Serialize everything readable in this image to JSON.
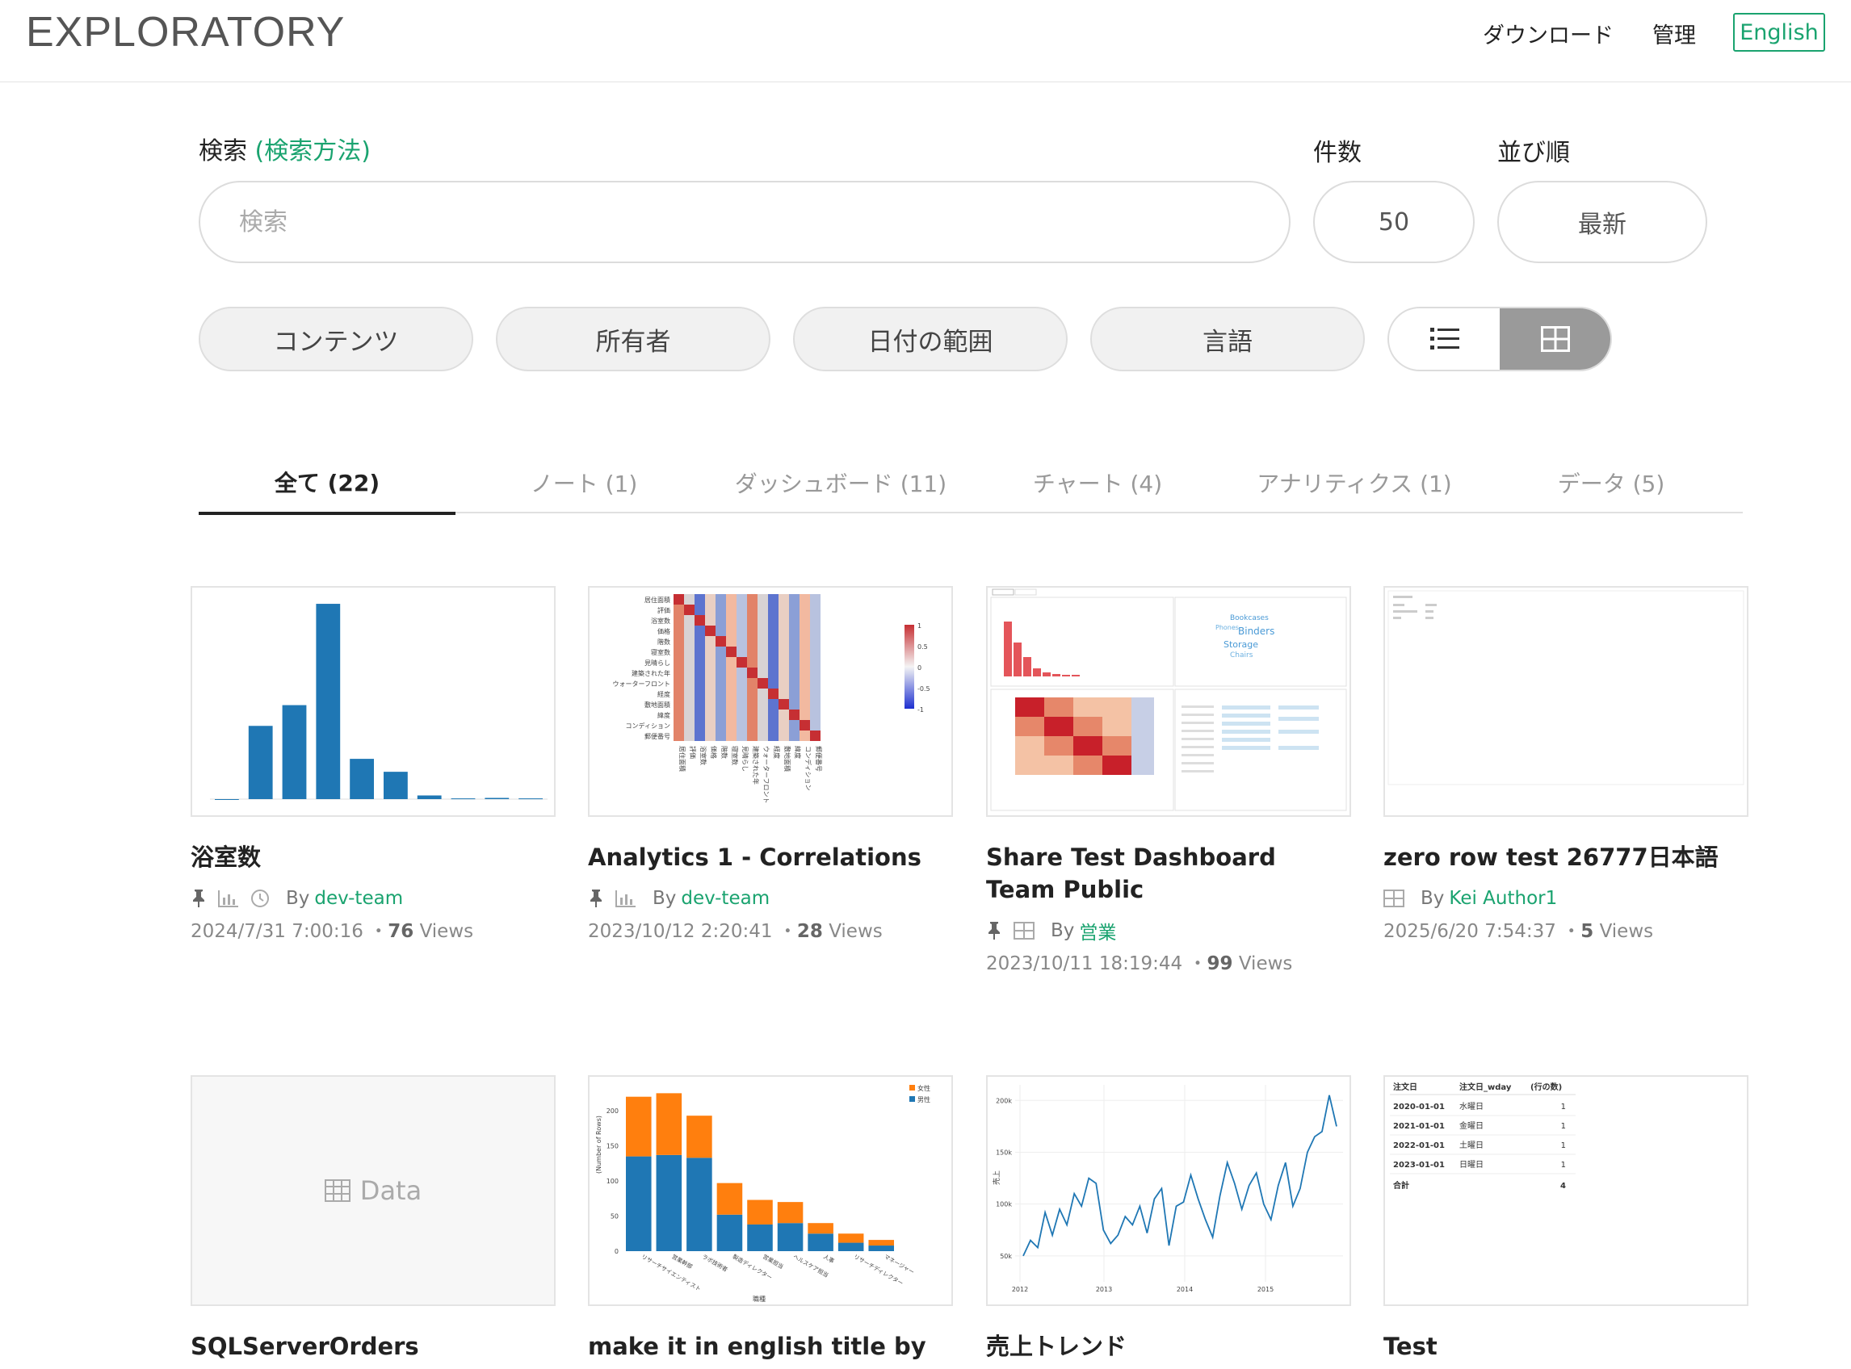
{
  "header": {
    "logo": "EXPLORATORY",
    "nav": {
      "download": "ダウンロード",
      "admin": "管理"
    },
    "language_button": "English"
  },
  "search": {
    "label": "検索",
    "help_link": "(検索方法)",
    "placeholder": "検索",
    "count_label": "件数",
    "count_value": "50",
    "sort_label": "並び順",
    "sort_value": "最新"
  },
  "filters": [
    "コンテンツ",
    "所有者",
    "日付の範囲",
    "言語"
  ],
  "view_toggle": {
    "list_icon": "list-icon",
    "grid_icon": "grid-icon",
    "active": "grid"
  },
  "tabs": [
    {
      "label": "全て (22)",
      "active": true
    },
    {
      "label": "ノート (1)",
      "active": false
    },
    {
      "label": "ダッシュボード (11)",
      "active": false
    },
    {
      "label": "チャート (4)",
      "active": false
    },
    {
      "label": "アナリティクス (1)",
      "active": false
    },
    {
      "label": "データ (5)",
      "active": false
    }
  ],
  "cards": [
    {
      "title": "浴室数",
      "pinned": true,
      "type_icon": "chart-icon",
      "clock": true,
      "by": "By",
      "owner": "dev-team",
      "date": "2024/7/31 7:00:16",
      "views": "76",
      "views_label": "Views"
    },
    {
      "title": "Analytics 1 - Correlations",
      "pinned": true,
      "type_icon": "chart-icon",
      "clock": false,
      "by": "By",
      "owner": "dev-team",
      "date": "2023/10/12 2:20:41",
      "views": "28",
      "views_label": "Views"
    },
    {
      "title": "Share Test Dashboard Team Public",
      "pinned": true,
      "type_icon": "dashboard-icon",
      "clock": false,
      "by": "By",
      "owner": "営業",
      "date": "2023/10/11 18:19:44",
      "views": "99",
      "views_label": "Views"
    },
    {
      "title": "zero row test 26777日本語",
      "pinned": false,
      "type_icon": "dashboard-icon",
      "clock": false,
      "by": "By",
      "owner": "Kei Author1",
      "date": "2025/6/20 7:54:37",
      "views": "5",
      "views_label": "Views"
    },
    {
      "title": "SQLServerOrders",
      "placeholder": "Data"
    },
    {
      "title": "make it in english title by"
    },
    {
      "title": "売上トレンド"
    },
    {
      "title": "Test"
    }
  ],
  "colors": {
    "accent": "#1aa36f",
    "bar_blue": "#1f77b4",
    "bar_orange": "#ff7f0e",
    "toggle_active": "#9a9a9a"
  },
  "chart_data": [
    {
      "type": "bar",
      "values": [
        0,
        300,
        385,
        800,
        165,
        112,
        15,
        3,
        5,
        3
      ]
    },
    {
      "type": "heatmap",
      "categories": [
        "居住面積",
        "評価",
        "浴室数",
        "価格",
        "階数",
        "寝室数",
        "見晴らし",
        "建築された年",
        "ウォーターフロント",
        "経度",
        "敷地面積",
        "緯度",
        "コンディション",
        "郵便番号"
      ],
      "legend_ticks": [
        "1",
        "0.5",
        "0",
        "-0.5",
        "-1"
      ]
    },
    {
      "type": "bar",
      "categories": [
        "リサーチサイエンティスト",
        "営業幹部",
        "ラボ技術者",
        "製造ディレクター",
        "営業担当",
        "ヘルスケア担当",
        "人事",
        "リサーチディレクター",
        "マネージャー"
      ],
      "series": [
        {
          "name": "女性",
          "values": [
            85,
            88,
            60,
            45,
            35,
            30,
            15,
            13,
            8
          ]
        },
        {
          "name": "男性",
          "values": [
            135,
            137,
            133,
            52,
            38,
            40,
            25,
            12,
            8
          ]
        }
      ],
      "xlabel": "職種",
      "ylabel": "(Number of Rows)",
      "yticks": [
        "0",
        "50",
        "100",
        "150",
        "200"
      ],
      "ylim": [
        0,
        230
      ]
    },
    {
      "type": "line",
      "xticks": [
        "2012",
        "2013",
        "2014",
        "2015"
      ],
      "yticks": [
        "50k",
        "100k",
        "150k",
        "200k"
      ],
      "ylabel": "売上",
      "ylim": [
        25000,
        215000
      ],
      "values": [
        50000,
        65000,
        58000,
        92000,
        70000,
        95000,
        80000,
        110000,
        98000,
        125000,
        120000,
        75000,
        62000,
        70000,
        88000,
        80000,
        98000,
        72000,
        105000,
        115000,
        60000,
        98000,
        102000,
        128000,
        105000,
        85000,
        68000,
        108000,
        140000,
        120000,
        95000,
        118000,
        130000,
        100000,
        85000,
        118000,
        140000,
        98000,
        115000,
        150000,
        165000,
        170000,
        205000,
        175000
      ]
    },
    {
      "type": "table",
      "columns": [
        "注文日",
        "注文日_wday",
        "(行の数)"
      ],
      "rows": [
        [
          "2020-01-01",
          "水曜日",
          "1"
        ],
        [
          "2021-01-01",
          "金曜日",
          "1"
        ],
        [
          "2022-01-01",
          "土曜日",
          "1"
        ],
        [
          "2023-01-01",
          "日曜日",
          "1"
        ]
      ],
      "total_label": "合計",
      "total_value": "4"
    }
  ]
}
